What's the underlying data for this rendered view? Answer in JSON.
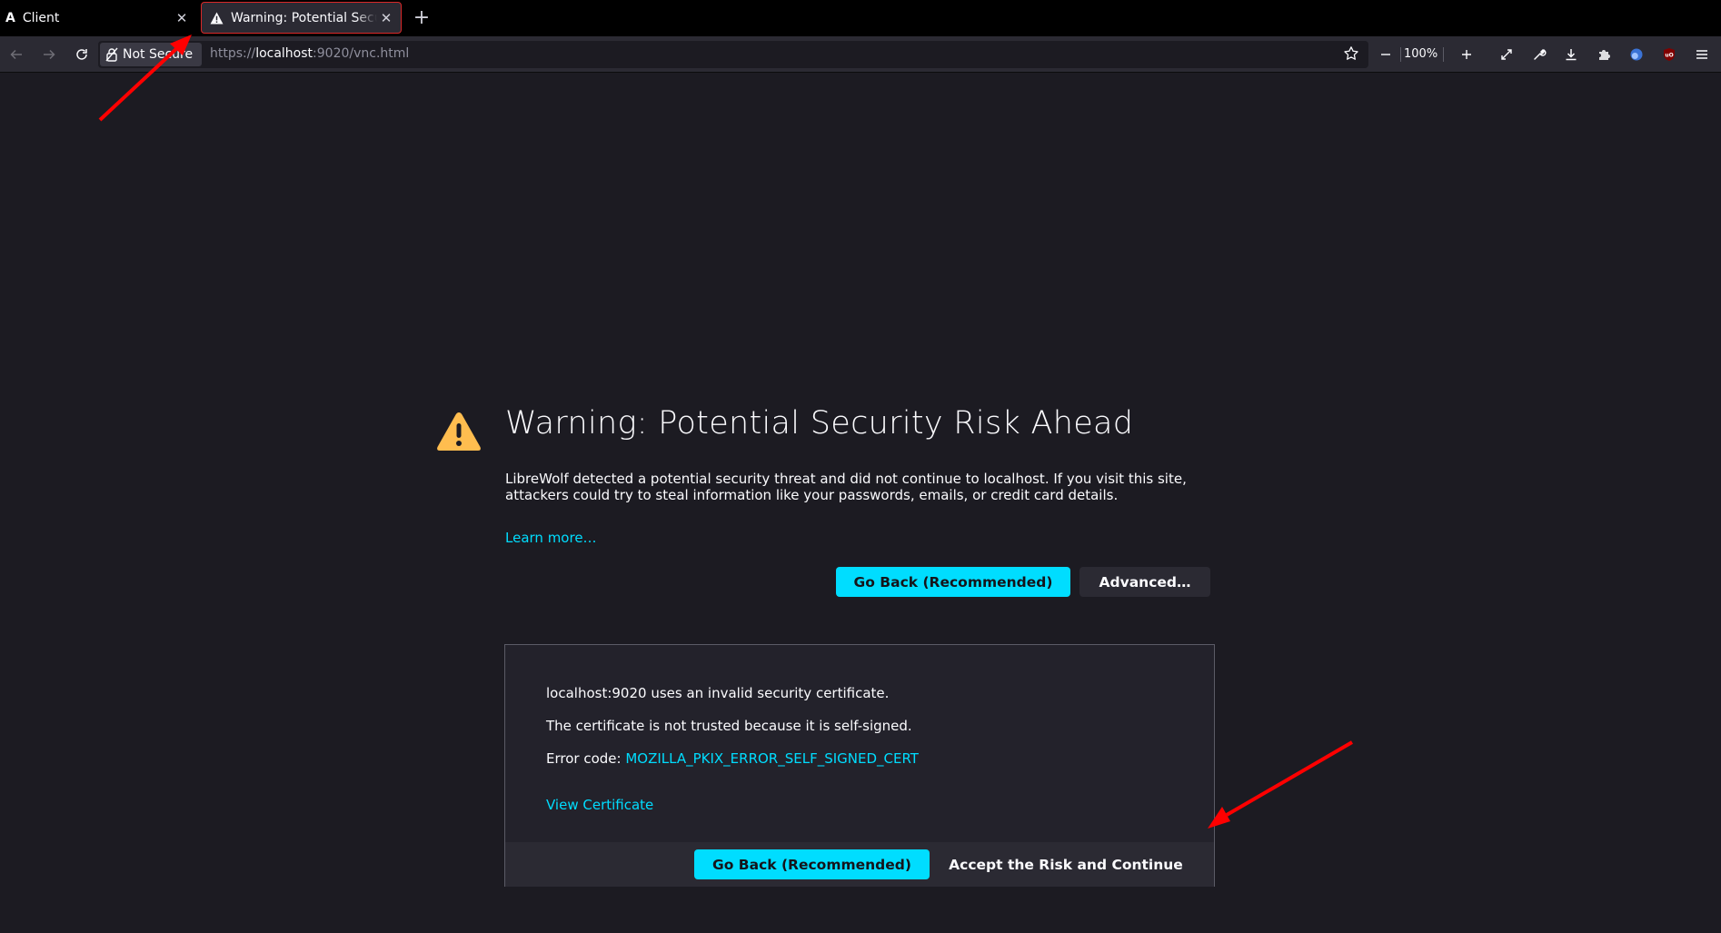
{
  "tabs": [
    {
      "title": "Client",
      "icon": "app-a-icon"
    },
    {
      "title": "Warning: Potential Security Risk Ahead",
      "icon": "warning-icon"
    }
  ],
  "toolbar": {
    "security_label": "Not Secure",
    "url_scheme": "https://",
    "url_host": "localhost",
    "url_rest": ":9020/vnc.html",
    "zoom": "100%"
  },
  "error_page": {
    "title": "Warning: Potential Security Risk Ahead",
    "description": "LibreWolf detected a potential security threat and did not continue to localhost. If you visit this site, attackers could try to steal information like your passwords, emails, or credit card details.",
    "learn_more": "Learn more…",
    "go_back_label": "Go Back (Recommended)",
    "advanced_label": "Advanced…"
  },
  "advanced_panel": {
    "line1": "localhost:9020 uses an invalid security certificate.",
    "line2": "The certificate is not trusted because it is self-signed.",
    "error_code_prefix": "Error code: ",
    "error_code": "MOZILLA_PKIX_ERROR_SELF_SIGNED_CERT",
    "view_certificate": "View Certificate",
    "go_back_label": "Go Back (Recommended)",
    "accept_label": "Accept the Risk and Continue"
  },
  "colors": {
    "accent": "#00ddff",
    "background": "#1c1b22",
    "warning": "#ffbd4f",
    "annotation": "#ff0000"
  }
}
